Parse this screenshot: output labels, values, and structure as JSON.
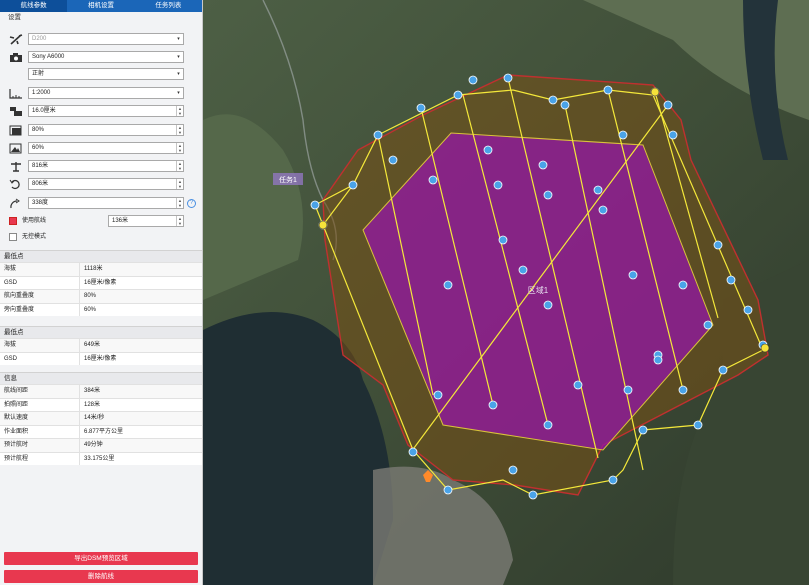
{
  "tabs": [
    "航线参数",
    "相机设置",
    "任务列表"
  ],
  "settings": {
    "section_title": "设置",
    "aircraft": "D200",
    "camera": "Sony A6000",
    "mount": "正射",
    "scale": "1:2000",
    "gsd": "16.0厘米",
    "front_overlap": "80%",
    "side_overlap": "60%",
    "altitude": "816米",
    "altitude2": "806米",
    "heading": "338度",
    "use_route_label": "使用航线",
    "use_route_value": "136米",
    "no_control_label": "无控模式"
  },
  "highest_point": {
    "title": "最低点",
    "rows": [
      {
        "k": "海拔",
        "v": "1118米"
      },
      {
        "k": "GSD",
        "v": "16厘米/像素"
      },
      {
        "k": "航向重叠度",
        "v": "80%"
      },
      {
        "k": "旁向重叠度",
        "v": "60%"
      }
    ]
  },
  "lowest_point": {
    "title": "最低点",
    "rows": [
      {
        "k": "海拔",
        "v": "649米"
      },
      {
        "k": "GSD",
        "v": "16厘米/像素"
      }
    ]
  },
  "info": {
    "title": "信息",
    "rows": [
      {
        "k": "航线间距",
        "v": "384米"
      },
      {
        "k": "拍照间距",
        "v": "128米"
      },
      {
        "k": "默认速度",
        "v": "14米/秒"
      },
      {
        "k": "作业面积",
        "v": "6.877平方公里"
      },
      {
        "k": "预计航时",
        "v": "49分钟"
      },
      {
        "k": "预计航程",
        "v": "33.175公里"
      }
    ]
  },
  "buttons": {
    "export": "导出DSM预览区域",
    "delete": "删除航线"
  },
  "map": {
    "region_label": "区域1",
    "task_label": "任务1"
  }
}
